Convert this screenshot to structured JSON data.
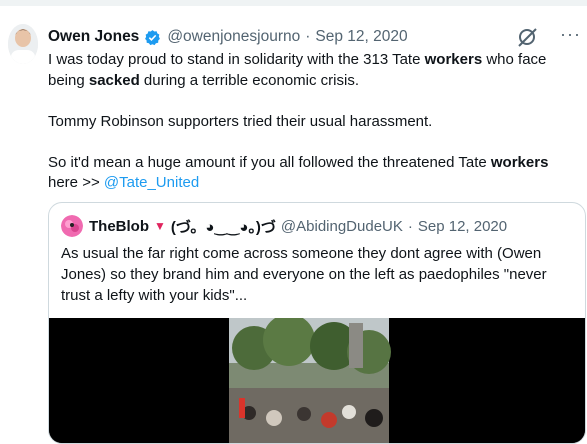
{
  "tweet": {
    "author_name": "Owen Jones",
    "handle": "@owenjonesjourno",
    "separator": "·",
    "date": "Sep 12, 2020",
    "line1_a": "I was today proud to stand in solidarity with the 313 Tate ",
    "line1_bold": "workers",
    "line1_b": " who face",
    "line2_a": "being ",
    "line2_bold": "sacked",
    "line2_b": " during a terrible economic crisis.",
    "para2": "Tommy Robinson supporters tried their usual harassment.",
    "para3_a": "So it'd mean a huge amount if you all followed the threatened Tate ",
    "para3_bold": "workers",
    "para3_b": "here >> ",
    "mention": "@Tate_United"
  },
  "quote": {
    "author_name": "TheBlob",
    "triangle": "▼",
    "kaomoji": "(づ。◕‿‿◕。)づ",
    "handle": "@AbidingDudeUK",
    "separator": "·",
    "date": "Sep 12, 2020",
    "text": "As usual the far right come across someone they dont agree with (Owen Jones) so they brand him and everyone on the left as paedophiles \"never trust a lefty with your kids\"..."
  },
  "icons": {
    "verified": "verified-badge-icon",
    "grok": "grok-icon",
    "more": "more-icon"
  },
  "colors": {
    "link": "#1d9bf0",
    "muted": "#536471",
    "verified": "#1d9bf0"
  }
}
